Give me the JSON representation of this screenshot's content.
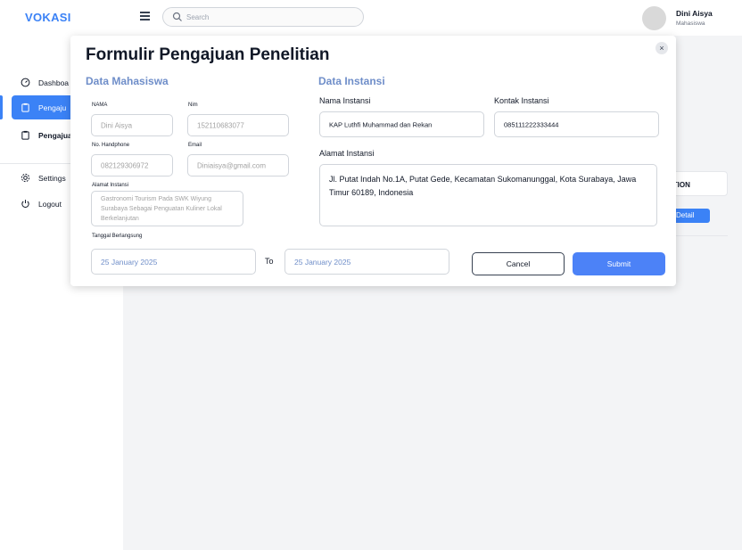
{
  "app": {
    "logo": "VOKASI"
  },
  "search": {
    "placeholder": "Search"
  },
  "user": {
    "name": "Dini Aisya",
    "role": "Mahasiswa"
  },
  "sidebar": {
    "items": [
      {
        "label": "Dashboa"
      },
      {
        "label": "Pengaju"
      },
      {
        "label": "Pengajua"
      },
      {
        "label": "Settings"
      },
      {
        "label": "Logout"
      }
    ]
  },
  "background": {
    "table_header": "CTION",
    "detail_button": "Detail"
  },
  "modal": {
    "title": "Formulir Pengajuan Penelitian",
    "close_icon": "×",
    "mahasiswa": {
      "section_title": "Data Mahasiswa",
      "nama_label": "NAMA",
      "nama_value": "Dini Aisya",
      "nim_label": "Nim",
      "nim_value": "152110683077",
      "hp_label": "No. Handphone",
      "hp_value": "082129306972",
      "email_label": "Email",
      "email_value": "Diniaisya@gmail.com",
      "alamat_label": "Alamat Instansi",
      "alamat_value": "Gastronomi Tourism Pada SWK Wiyung Surabaya Sebagai Penguatan Kuliner Lokal Berkelanjutan",
      "tanggal_label": "Tanggal Berlangsung",
      "tanggal_start": "25 January 2025",
      "to_label": "To",
      "tanggal_end": "25 January 2025"
    },
    "instansi": {
      "section_title": "Data Instansi",
      "nama_label": "Nama Instansi",
      "nama_value": "KAP Luthfi Muhammad dan Rekan",
      "kontak_label": "Kontak Instansi",
      "kontak_value": "085111222333444",
      "alamat_label": "Alamat Instansi",
      "alamat_value": "Jl. Putat Indah No.1A, Putat Gede, Kecamatan Sukomanunggal, Kota Surabaya, Jawa Timur 60189, Indonesia"
    },
    "cancel_label": "Cancel",
    "submit_label": "Submit"
  }
}
